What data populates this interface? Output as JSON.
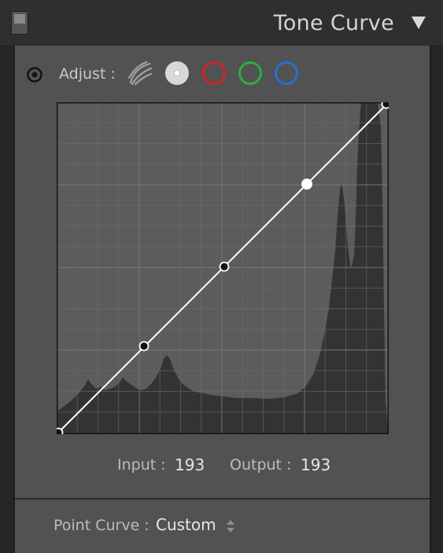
{
  "panel": {
    "title": "Tone Curve"
  },
  "adjust": {
    "label": "Adjust :",
    "channels": [
      {
        "name": "parametric-icon",
        "color": "#9a9a9a"
      },
      {
        "name": "rgb-channel-icon",
        "color": "#d8d8d8"
      },
      {
        "name": "red-channel-icon",
        "color": "#d3232a"
      },
      {
        "name": "green-channel-icon",
        "color": "#2eae3c"
      },
      {
        "name": "blue-channel-icon",
        "color": "#2271d6"
      }
    ]
  },
  "readout": {
    "input_label": "Input :",
    "input_value": "193",
    "output_label": "Output :",
    "output_value": "193"
  },
  "point_curve": {
    "label": "Point Curve :",
    "value": "Custom"
  }
}
